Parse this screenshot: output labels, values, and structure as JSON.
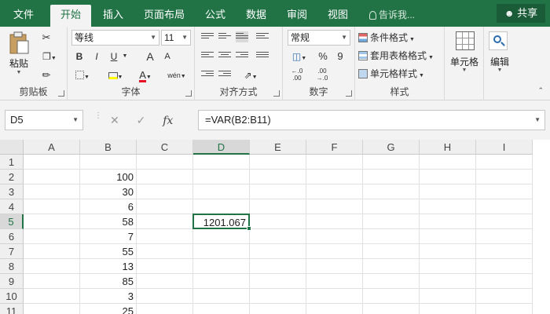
{
  "tabs": [
    {
      "label": "文件",
      "active": false
    },
    {
      "label": "开始",
      "active": true
    },
    {
      "label": "插入",
      "active": false
    },
    {
      "label": "页面布局",
      "active": false
    },
    {
      "label": "公式",
      "active": false
    },
    {
      "label": "数据",
      "active": false
    },
    {
      "label": "审阅",
      "active": false
    },
    {
      "label": "视图",
      "active": false
    }
  ],
  "tell_me": "告诉我...",
  "share": "共享",
  "ribbon": {
    "clipboard": {
      "paste": "粘贴",
      "label": "剪贴板"
    },
    "font": {
      "name": "等线",
      "size": "11",
      "bold": "B",
      "italic": "I",
      "underline": "U",
      "grow": "A",
      "shrink": "A",
      "wen": "wén",
      "label": "字体"
    },
    "alignment": {
      "label": "对齐方式"
    },
    "number": {
      "format": "常规",
      "percent": "%",
      "comma": "9",
      "label": "数字"
    },
    "styles": {
      "conditional": "条件格式",
      "table": "套用表格格式",
      "cell": "单元格样式",
      "label": "样式"
    },
    "cells": {
      "label": "单元格"
    },
    "editing": {
      "label": "编辑"
    }
  },
  "formula_bar": {
    "name_box": "D5",
    "fx": "fx",
    "formula": "=VAR(B2:B11)"
  },
  "grid": {
    "columns": [
      "A",
      "B",
      "C",
      "D",
      "E",
      "F",
      "G",
      "H",
      "I"
    ],
    "selected_column": "D",
    "rows": [
      "1",
      "2",
      "3",
      "4",
      "5",
      "6",
      "7",
      "8",
      "9",
      "10",
      "11"
    ],
    "selected_row": "5",
    "column_b": [
      "",
      "100",
      "30",
      "6",
      "58",
      "7",
      "55",
      "13",
      "85",
      "3",
      "25"
    ],
    "active_cell": {
      "column": "D",
      "row": "5",
      "value": "1201.067"
    }
  },
  "colors": {
    "accent": "#217346"
  }
}
